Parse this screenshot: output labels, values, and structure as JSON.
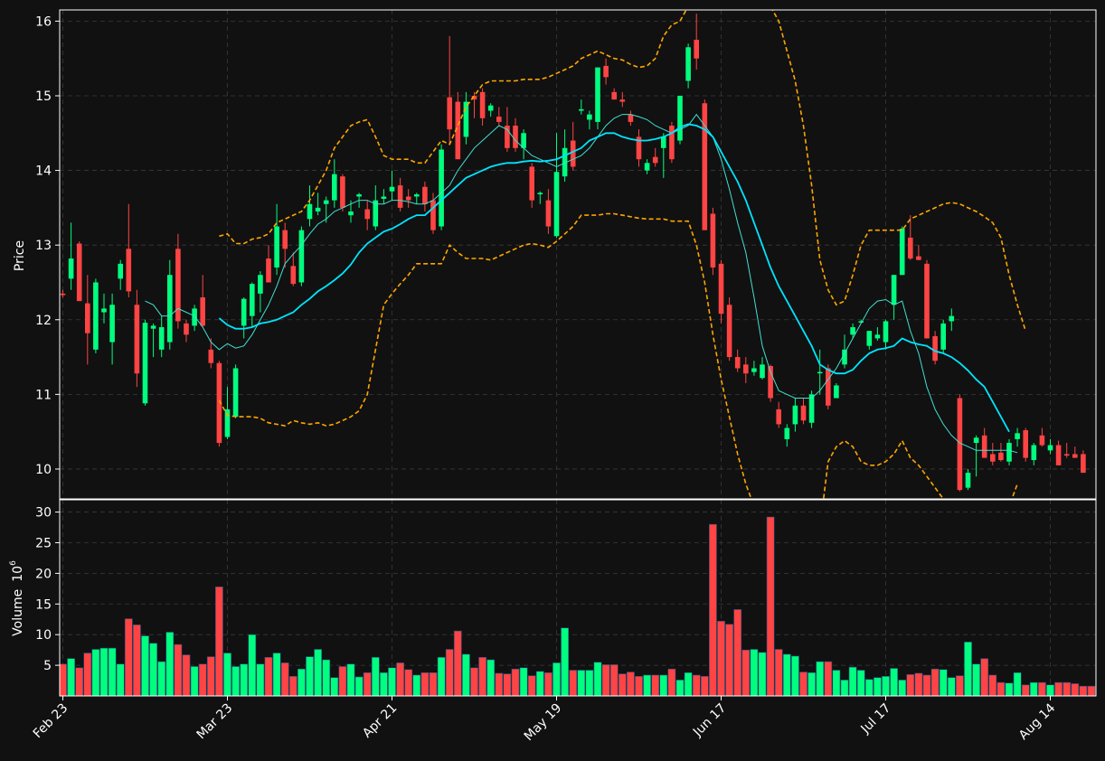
{
  "chart_data": {
    "type": "candlestick",
    "price_panel": {
      "ylabel": "Price",
      "ylim": [
        9.6,
        16.15
      ],
      "yticks": [
        10,
        11,
        12,
        13,
        14,
        15,
        16
      ],
      "grid": true
    },
    "volume_panel": {
      "ylabel": "Volume",
      "ylabel_exponent": "10",
      "ylabel_power": "6",
      "ylim": [
        0,
        32
      ],
      "yticks": [
        5,
        10,
        15,
        20,
        25,
        30
      ],
      "grid": true
    },
    "x_ticks": [
      {
        "label": "Feb 23",
        "index": 0
      },
      {
        "label": "Mar 23",
        "index": 20
      },
      {
        "label": "Apr 21",
        "index": 40
      },
      {
        "label": "May 19",
        "index": 60
      },
      {
        "label": "Jun 17",
        "index": 80
      },
      {
        "label": "Jul 17",
        "index": 100
      },
      {
        "label": "Aug 14",
        "index": 120
      }
    ],
    "colors": {
      "up": "#00ff7f",
      "down": "#ff4444",
      "ma_fast": "#40e0d0",
      "ma_slow": "#00e5ff",
      "bands": "#ffa500",
      "background": "#111111",
      "grid": "#3a3a3a",
      "spine": "#ffffff"
    },
    "candles": [
      [
        12.35,
        12.4,
        12.3,
        12.33
      ],
      [
        12.55,
        13.3,
        12.4,
        12.82
      ],
      [
        13.02,
        13.05,
        12.25,
        12.25
      ],
      [
        12.22,
        12.6,
        11.4,
        11.82
      ],
      [
        11.6,
        12.55,
        11.55,
        12.5
      ],
      [
        12.1,
        12.35,
        11.95,
        12.15
      ],
      [
        11.7,
        12.35,
        11.4,
        12.2
      ],
      [
        12.55,
        12.8,
        12.4,
        12.75
      ],
      [
        12.95,
        13.55,
        12.3,
        12.38
      ],
      [
        12.2,
        12.4,
        11.1,
        11.28
      ],
      [
        10.88,
        12.0,
        10.85,
        11.96
      ],
      [
        11.88,
        11.95,
        11.5,
        11.92
      ],
      [
        11.6,
        12.05,
        11.5,
        11.9
      ],
      [
        11.7,
        12.8,
        11.6,
        12.6
      ],
      [
        12.95,
        13.15,
        11.88,
        11.98
      ],
      [
        11.95,
        12.0,
        11.7,
        11.8
      ],
      [
        11.92,
        12.2,
        11.85,
        12.15
      ],
      [
        12.3,
        12.6,
        11.9,
        11.92
      ],
      [
        11.6,
        11.75,
        11.35,
        11.42
      ],
      [
        11.42,
        11.45,
        10.3,
        10.35
      ],
      [
        10.43,
        11.1,
        10.4,
        10.8
      ],
      [
        10.7,
        11.4,
        10.68,
        11.35
      ],
      [
        11.92,
        12.3,
        11.75,
        12.28
      ],
      [
        12.05,
        12.5,
        11.9,
        12.48
      ],
      [
        12.35,
        12.65,
        12.1,
        12.6
      ],
      [
        12.82,
        13.0,
        12.5,
        12.5
      ],
      [
        12.7,
        13.55,
        12.6,
        13.25
      ],
      [
        13.2,
        13.3,
        12.7,
        12.95
      ],
      [
        12.72,
        12.9,
        12.45,
        12.48
      ],
      [
        12.5,
        13.25,
        12.45,
        13.2
      ],
      [
        13.35,
        13.8,
        13.25,
        13.55
      ],
      [
        13.45,
        13.7,
        13.4,
        13.5
      ],
      [
        13.55,
        13.65,
        13.3,
        13.6
      ],
      [
        13.6,
        14.15,
        13.5,
        13.95
      ],
      [
        13.92,
        13.95,
        13.45,
        13.5
      ],
      [
        13.4,
        13.6,
        13.3,
        13.45
      ],
      [
        13.65,
        13.7,
        13.5,
        13.68
      ],
      [
        13.48,
        13.6,
        13.2,
        13.35
      ],
      [
        13.25,
        13.8,
        13.2,
        13.6
      ],
      [
        13.62,
        13.75,
        13.55,
        13.65
      ],
      [
        13.72,
        14.0,
        13.6,
        13.78
      ],
      [
        13.8,
        13.9,
        13.45,
        13.5
      ],
      [
        13.65,
        13.75,
        13.5,
        13.6
      ],
      [
        13.65,
        13.7,
        13.55,
        13.68
      ],
      [
        13.78,
        13.85,
        13.45,
        13.55
      ],
      [
        13.6,
        13.7,
        13.15,
        13.2
      ],
      [
        13.25,
        14.35,
        13.2,
        14.28
      ],
      [
        14.98,
        15.8,
        14.35,
        14.55
      ],
      [
        14.92,
        15.05,
        14.15,
        14.15
      ],
      [
        14.45,
        15.05,
        14.35,
        14.92
      ],
      [
        15.0,
        15.05,
        14.7,
        14.95
      ],
      [
        15.05,
        15.1,
        14.6,
        14.7
      ],
      [
        14.8,
        14.9,
        14.72,
        14.87
      ],
      [
        14.72,
        14.85,
        14.6,
        14.65
      ],
      [
        14.6,
        14.85,
        14.25,
        14.3
      ],
      [
        14.6,
        14.7,
        14.25,
        14.3
      ],
      [
        14.3,
        14.55,
        14.15,
        14.5
      ],
      [
        14.05,
        14.1,
        13.5,
        13.6
      ],
      [
        13.68,
        13.72,
        13.55,
        13.7
      ],
      [
        13.6,
        13.75,
        13.15,
        13.25
      ],
      [
        13.12,
        14.5,
        13.1,
        13.98
      ],
      [
        13.92,
        14.55,
        13.85,
        14.3
      ],
      [
        14.4,
        14.65,
        14.0,
        14.05
      ],
      [
        14.8,
        14.95,
        14.75,
        14.82
      ],
      [
        14.68,
        14.8,
        14.55,
        14.75
      ],
      [
        14.65,
        15.35,
        14.55,
        15.38
      ],
      [
        15.4,
        15.5,
        15.15,
        15.25
      ],
      [
        15.05,
        15.1,
        14.95,
        14.95
      ],
      [
        14.95,
        15.05,
        14.85,
        14.92
      ],
      [
        14.75,
        14.8,
        14.6,
        14.65
      ],
      [
        14.45,
        14.55,
        14.05,
        14.15
      ],
      [
        14.0,
        14.15,
        13.95,
        14.1
      ],
      [
        14.18,
        14.3,
        14.05,
        14.1
      ],
      [
        14.3,
        14.5,
        13.9,
        14.45
      ],
      [
        14.6,
        14.65,
        14.1,
        14.15
      ],
      [
        14.4,
        15.0,
        14.35,
        15.0
      ],
      [
        15.2,
        15.7,
        15.1,
        15.65
      ],
      [
        15.75,
        16.1,
        15.35,
        15.5
      ],
      [
        14.9,
        14.95,
        13.2,
        13.2
      ],
      [
        13.42,
        13.5,
        12.6,
        12.7
      ],
      [
        12.75,
        12.8,
        11.95,
        12.08
      ],
      [
        12.2,
        12.3,
        11.45,
        11.5
      ],
      [
        11.5,
        11.6,
        11.3,
        11.35
      ],
      [
        11.4,
        11.5,
        11.15,
        11.28
      ],
      [
        11.3,
        11.45,
        11.25,
        11.35
      ],
      [
        11.22,
        11.5,
        11.2,
        11.4
      ],
      [
        11.38,
        11.4,
        10.9,
        10.95
      ],
      [
        10.8,
        10.9,
        10.55,
        10.6
      ],
      [
        10.4,
        10.6,
        10.3,
        10.55
      ],
      [
        10.6,
        10.95,
        10.5,
        10.85
      ],
      [
        10.85,
        10.95,
        10.6,
        10.65
      ],
      [
        10.62,
        11.05,
        10.55,
        11.0
      ],
      [
        11.3,
        11.6,
        11.0,
        11.3
      ],
      [
        11.35,
        11.4,
        10.8,
        10.85
      ],
      [
        10.95,
        11.15,
        10.95,
        11.12
      ],
      [
        11.4,
        11.8,
        11.35,
        11.6
      ],
      [
        11.8,
        11.95,
        11.75,
        11.9
      ],
      [
        11.98,
        12.0,
        11.95,
        11.98
      ],
      [
        11.65,
        11.85,
        11.6,
        11.85
      ],
      [
        11.75,
        11.9,
        11.72,
        11.8
      ],
      [
        11.7,
        12.0,
        11.6,
        11.98
      ],
      [
        12.2,
        12.6,
        12.0,
        12.6
      ],
      [
        12.6,
        13.25,
        12.6,
        13.22
      ],
      [
        13.1,
        13.4,
        12.8,
        12.82
      ],
      [
        12.85,
        13.0,
        12.8,
        12.8
      ],
      [
        12.75,
        12.8,
        11.75,
        11.75
      ],
      [
        11.78,
        11.85,
        11.4,
        11.45
      ],
      [
        11.6,
        12.0,
        11.55,
        11.95
      ],
      [
        11.98,
        12.15,
        11.85,
        12.05
      ],
      [
        10.95,
        11.0,
        9.7,
        9.72
      ],
      [
        9.75,
        10.0,
        9.72,
        9.95
      ],
      [
        10.35,
        10.45,
        9.9,
        10.42
      ],
      [
        10.45,
        10.55,
        10.15,
        10.15
      ],
      [
        10.2,
        10.35,
        10.05,
        10.1
      ],
      [
        10.22,
        10.35,
        10.1,
        10.12
      ],
      [
        10.1,
        10.4,
        10.05,
        10.35
      ],
      [
        10.4,
        10.55,
        10.3,
        10.48
      ],
      [
        10.52,
        10.55,
        10.1,
        10.15
      ],
      [
        10.12,
        10.35,
        10.05,
        10.32
      ],
      [
        10.45,
        10.55,
        10.3,
        10.32
      ],
      [
        10.25,
        10.4,
        10.2,
        10.32
      ],
      [
        10.32,
        10.38,
        10.05,
        10.05
      ],
      [
        10.2,
        10.35,
        10.15,
        10.18
      ],
      [
        10.2,
        10.3,
        10.15,
        10.15
      ],
      [
        10.2,
        10.25,
        9.95,
        9.95
      ]
    ],
    "volumes": [
      5.2,
      6.1,
      4.6,
      7.0,
      7.6,
      7.8,
      7.8,
      5.2,
      12.6,
      11.6,
      9.8,
      8.6,
      5.6,
      10.4,
      8.4,
      6.7,
      4.8,
      5.2,
      6.4,
      17.8,
      7.0,
      4.8,
      5.2,
      10.0,
      5.2,
      6.3,
      7.0,
      5.4,
      3.2,
      4.4,
      6.4,
      7.6,
      5.9,
      3.0,
      4.8,
      5.2,
      3.1,
      3.8,
      6.3,
      3.8,
      4.6,
      5.4,
      4.3,
      3.4,
      3.8,
      3.8,
      6.3,
      7.6,
      10.6,
      6.8,
      4.6,
      6.3,
      5.9,
      3.7,
      3.6,
      4.4,
      4.6,
      3.3,
      4.0,
      3.8,
      5.4,
      11.1,
      4.2,
      4.2,
      4.2,
      5.5,
      5.1,
      5.1,
      3.6,
      3.9,
      3.2,
      3.4,
      3.4,
      3.4,
      4.4,
      2.6,
      3.8,
      3.4,
      3.2,
      28.0,
      12.2,
      11.7,
      14.1,
      7.5,
      7.6,
      7.1,
      29.2,
      7.6,
      6.8,
      6.5,
      3.9,
      3.8,
      5.6,
      5.6,
      4.2,
      2.6,
      4.7,
      4.2,
      2.7,
      3.0,
      3.2,
      4.5,
      2.6,
      3.5,
      3.7,
      3.4,
      4.4,
      4.3,
      3.0,
      3.3,
      8.8,
      5.2,
      6.1,
      3.4,
      2.2,
      2.1,
      3.8,
      1.8,
      2.2,
      2.2,
      1.8,
      2.2,
      2.2,
      2.0,
      1.6,
      1.6
    ],
    "ma_fast": [
      null,
      null,
      null,
      null,
      null,
      null,
      null,
      null,
      null,
      null,
      12.25,
      12.2,
      12.05,
      12.05,
      12.15,
      12.1,
      12.05,
      11.9,
      11.7,
      11.6,
      11.68,
      11.62,
      11.65,
      11.8,
      12.0,
      12.2,
      12.45,
      12.75,
      12.88,
      13.0,
      13.15,
      13.28,
      13.35,
      13.45,
      13.5,
      13.55,
      13.6,
      13.6,
      13.55,
      13.55,
      13.6,
      13.6,
      13.58,
      13.55,
      13.55,
      13.6,
      13.7,
      13.8,
      14.0,
      14.15,
      14.3,
      14.4,
      14.5,
      14.6,
      14.55,
      14.4,
      14.3,
      14.2,
      14.15,
      14.1,
      14.05,
      14.1,
      14.15,
      14.2,
      14.3,
      14.45,
      14.6,
      14.7,
      14.75,
      14.75,
      14.72,
      14.68,
      14.6,
      14.55,
      14.5,
      14.55,
      14.6,
      14.75,
      14.6,
      14.45,
      14.15,
      13.75,
      13.3,
      12.9,
      12.3,
      11.65,
      11.3,
      11.05,
      11.0,
      10.95,
      10.95,
      10.95,
      11.05,
      11.2,
      11.35,
      11.55,
      11.75,
      11.95,
      12.15,
      12.25,
      12.27,
      12.2,
      12.25,
      11.85,
      11.55,
      11.1,
      10.8,
      10.6,
      10.45,
      10.35,
      10.3,
      10.25,
      10.25,
      10.25,
      10.25,
      10.25,
      10.22
    ],
    "ma_slow": [
      null,
      null,
      null,
      null,
      null,
      null,
      null,
      null,
      null,
      null,
      null,
      null,
      null,
      null,
      null,
      null,
      null,
      null,
      null,
      12.02,
      11.93,
      11.88,
      11.88,
      11.9,
      11.95,
      11.97,
      12.0,
      12.05,
      12.1,
      12.2,
      12.28,
      12.38,
      12.45,
      12.53,
      12.62,
      12.74,
      12.9,
      13.02,
      13.1,
      13.18,
      13.22,
      13.28,
      13.35,
      13.4,
      13.4,
      13.5,
      13.6,
      13.7,
      13.8,
      13.9,
      13.95,
      14.0,
      14.05,
      14.08,
      14.1,
      14.1,
      14.12,
      14.13,
      14.12,
      14.13,
      14.15,
      14.2,
      14.25,
      14.3,
      14.4,
      14.45,
      14.5,
      14.5,
      14.45,
      14.42,
      14.4,
      14.4,
      14.42,
      14.45,
      14.5,
      14.58,
      14.62,
      14.6,
      14.55,
      14.45,
      14.25,
      14.05,
      13.85,
      13.6,
      13.3,
      13.0,
      12.7,
      12.45,
      12.25,
      12.05,
      11.85,
      11.65,
      11.4,
      11.33,
      11.28,
      11.28,
      11.33,
      11.45,
      11.55,
      11.6,
      11.62,
      11.65,
      11.75,
      11.7,
      11.67,
      11.65,
      11.58,
      11.55,
      11.5,
      11.42,
      11.32,
      11.2,
      11.1,
      10.9,
      10.7,
      10.5
    ],
    "band_upper": [
      null,
      null,
      null,
      null,
      null,
      null,
      null,
      null,
      null,
      null,
      null,
      null,
      null,
      null,
      null,
      null,
      null,
      null,
      null,
      13.12,
      13.15,
      13.02,
      13.02,
      13.08,
      13.1,
      13.15,
      13.3,
      13.35,
      13.4,
      13.45,
      13.6,
      13.8,
      14.0,
      14.3,
      14.45,
      14.6,
      14.65,
      14.68,
      14.45,
      14.2,
      14.15,
      14.15,
      14.15,
      14.1,
      14.1,
      14.25,
      14.4,
      14.35,
      14.6,
      14.85,
      15.0,
      15.15,
      15.2,
      15.2,
      15.2,
      15.2,
      15.22,
      15.22,
      15.22,
      15.25,
      15.3,
      15.35,
      15.4,
      15.5,
      15.55,
      15.6,
      15.55,
      15.5,
      15.48,
      15.42,
      15.38,
      15.4,
      15.5,
      15.8,
      15.95,
      16.0,
      16.2,
      16.5,
      16.8,
      17.1,
      17.3,
      17.4,
      17.3,
      17.1,
      16.8,
      16.5,
      16.2,
      16.0,
      15.6,
      15.2,
      14.6,
      13.8,
      12.8,
      12.4,
      12.2,
      12.25,
      12.6,
      13.0,
      13.2,
      13.2,
      13.2,
      13.2,
      13.2,
      13.35,
      13.4,
      13.45,
      13.5,
      13.55,
      13.57,
      13.55,
      13.5,
      13.45,
      13.38,
      13.3,
      13.1,
      12.6,
      12.2,
      11.85
    ],
    "band_lower": [
      null,
      null,
      null,
      null,
      null,
      null,
      null,
      null,
      null,
      null,
      null,
      null,
      null,
      null,
      null,
      null,
      null,
      null,
      null,
      10.92,
      10.72,
      10.7,
      10.7,
      10.7,
      10.68,
      10.62,
      10.6,
      10.58,
      10.65,
      10.62,
      10.6,
      10.62,
      10.58,
      10.6,
      10.65,
      10.7,
      10.78,
      11.0,
      11.6,
      12.2,
      12.35,
      12.48,
      12.6,
      12.75,
      12.75,
      12.75,
      12.75,
      13.0,
      12.9,
      12.82,
      12.82,
      12.82,
      12.8,
      12.85,
      12.9,
      12.95,
      13.0,
      13.02,
      13.0,
      12.97,
      13.05,
      13.15,
      13.25,
      13.4,
      13.4,
      13.4,
      13.42,
      13.42,
      13.4,
      13.38,
      13.36,
      13.35,
      13.35,
      13.35,
      13.32,
      13.32,
      13.32,
      13.0,
      12.5,
      11.8,
      11.2,
      10.7,
      10.2,
      9.8,
      9.5,
      9.2,
      8.9,
      8.6,
      8.3,
      8.1,
      8.0,
      8.4,
      9.2,
      10.1,
      10.3,
      10.38,
      10.3,
      10.1,
      10.05,
      10.05,
      10.1,
      10.2,
      10.38,
      10.15,
      10.05,
      9.9,
      9.75,
      9.6,
      9.45,
      9.3,
      9.2,
      9.1,
      9.1,
      9.15,
      9.3,
      9.5,
      9.8
    ]
  }
}
